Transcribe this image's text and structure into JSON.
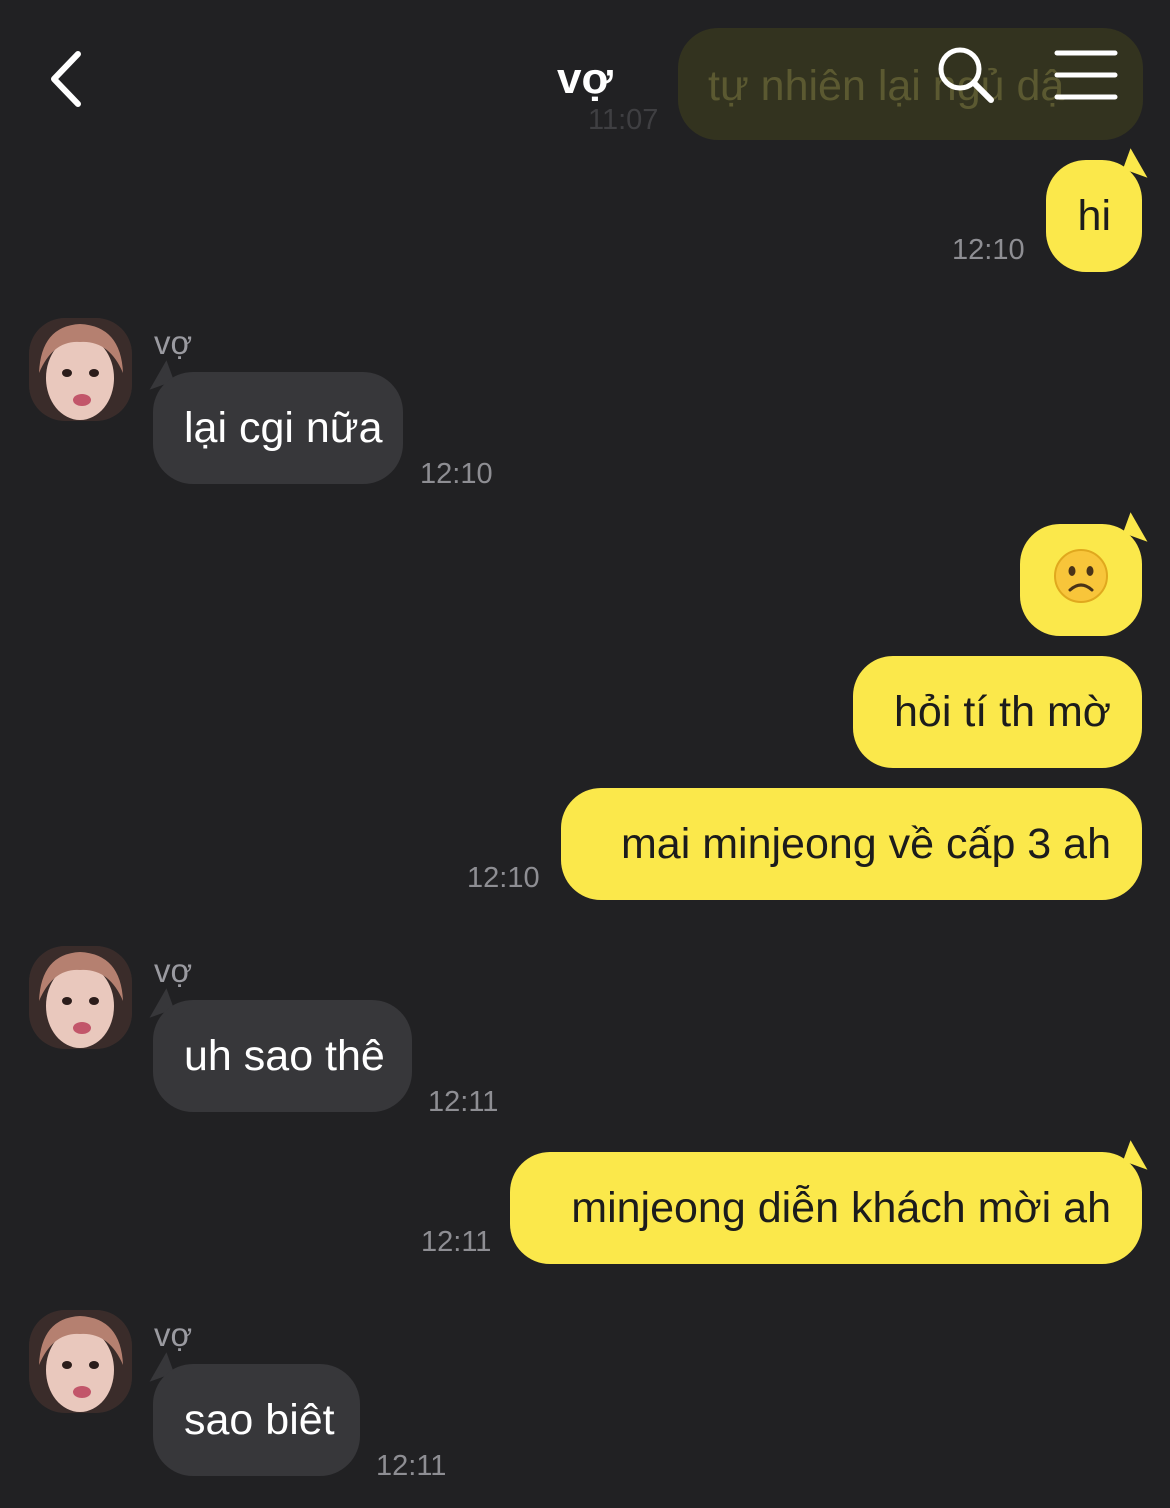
{
  "header": {
    "title": "vợ",
    "back_icon": "chevron-left-icon",
    "search_icon": "search-icon",
    "menu_icon": "hamburger-menu-icon"
  },
  "partial_top_message": {
    "text": "tự nhiên lại ngủ dậ",
    "time": "11:07"
  },
  "messages": [
    {
      "from": "me",
      "text": "hi",
      "time": "12:10"
    },
    {
      "from": "vợ",
      "sender": "vợ",
      "text": "lại cgi nữa",
      "time": "12:10"
    },
    {
      "from": "me",
      "text": "☹️"
    },
    {
      "from": "me",
      "text": "hỏi tí th mờ"
    },
    {
      "from": "me",
      "text": "mai minjeong về cấp 3 ah",
      "time": "12:10"
    },
    {
      "from": "vợ",
      "sender": "vợ",
      "text": "uh sao thê",
      "time": "12:11"
    },
    {
      "from": "me",
      "text": "minjeong diễn khách mời ah",
      "time": "12:11"
    },
    {
      "from": "vợ",
      "sender": "vợ",
      "text": "sao biêt",
      "time": "12:11"
    }
  ],
  "colors": {
    "background": "#212123",
    "outgoing_bubble": "#fbe84b",
    "incoming_bubble": "#37373a",
    "timestamp": "#8e8e93"
  }
}
